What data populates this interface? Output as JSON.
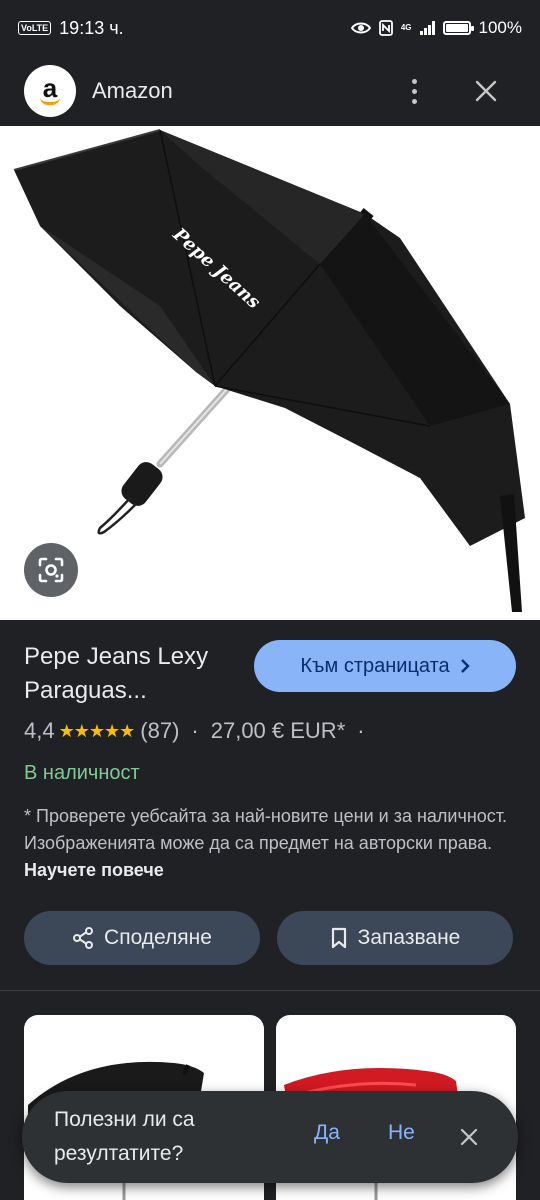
{
  "status_bar": {
    "volte": "VoLTE",
    "time": "19:13 ч.",
    "network": "4G",
    "battery_percent": "100%",
    "battery_level": 1.0
  },
  "header": {
    "logo_letter": "a",
    "site_name": "Amazon"
  },
  "product": {
    "title": "Pepe Jeans Lexy Paraguas...",
    "visit_button": "Към страницата",
    "rating": "4,4",
    "stars": "★★★★★",
    "reviews": "(87)",
    "price": "27,00 € EUR*",
    "availability": "В наличност",
    "disclaimer": "* Проверете уебсайта за най-новите цени и за наличност. Изображенията може да са предмет на авторски права.",
    "learn_more": "Научете повече",
    "umbrella_logo": "Pepe Jeans"
  },
  "actions": {
    "share": "Споделяне",
    "save": "Запазване"
  },
  "feedback": {
    "question": "Полезни ли са резултатите?",
    "yes": "Да",
    "no": "Не"
  },
  "colors": {
    "background": "#202124",
    "accent": "#8ab4f8",
    "in_stock": "#81c995",
    "star": "#fbbc04",
    "button_bg": "#3c4758"
  }
}
